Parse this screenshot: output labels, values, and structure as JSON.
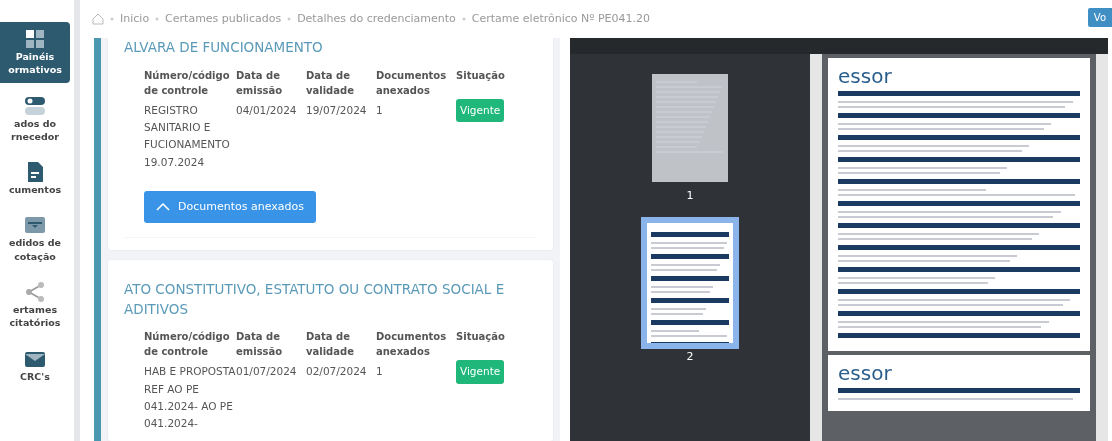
{
  "sidebar": {
    "items": [
      {
        "label": "Painéis ormativos",
        "kind": "grid",
        "selected": true
      },
      {
        "label": "ados do rnecedor",
        "kind": "toggle",
        "selected": false
      },
      {
        "label": "cumentos",
        "kind": "document",
        "selected": false
      },
      {
        "label": "edidos de cotação",
        "kind": "tray",
        "selected": false
      },
      {
        "label": "ertames citatórios",
        "kind": "share",
        "selected": false
      },
      {
        "label": "CRC's",
        "kind": "mail",
        "selected": false
      }
    ]
  },
  "breadcrumb": [
    "Inicio",
    "Certames publicados",
    "Detalhes do credenciamento",
    "Certame eletrônico Nº PE041.20"
  ],
  "top_button": "Vo",
  "documents": [
    {
      "title": "ALVARA DE FUNCIONAMENTO",
      "columns": [
        "Número/código de controle",
        "Data de emissão",
        "Data de validade",
        "Documentos anexados",
        "Situação"
      ],
      "row": {
        "code": "REGISTRO SANITARIO E FUCIONAMENTO 19.07.2024",
        "issued": "04/01/2024",
        "valid": "19/07/2024",
        "attachments": "1",
        "status": "Vigente"
      },
      "toggle": {
        "label": "Documentos anexados",
        "expanded": true
      }
    },
    {
      "title": "ATO CONSTITUTIVO, ESTATUTO OU CONTRATO SOCIAL E ADITIVOS",
      "columns": [
        "Número/código de controle",
        "Data de emissão",
        "Data de validade",
        "Documentos anexados",
        "Situação"
      ],
      "row": {
        "code": "HAB E PROPOSTA REF AO PE 041.2024- AO PE 041.2024-",
        "issued": "01/07/2024",
        "valid": "02/07/2024",
        "attachments": "1",
        "status": "Vigente"
      }
    }
  ],
  "viewer": {
    "thumbnails": [
      {
        "label": "1",
        "selected": false
      },
      {
        "label": "2",
        "selected": true
      }
    ],
    "pages": [
      {
        "logo": "essor"
      },
      {
        "logo": "essor"
      }
    ]
  }
}
